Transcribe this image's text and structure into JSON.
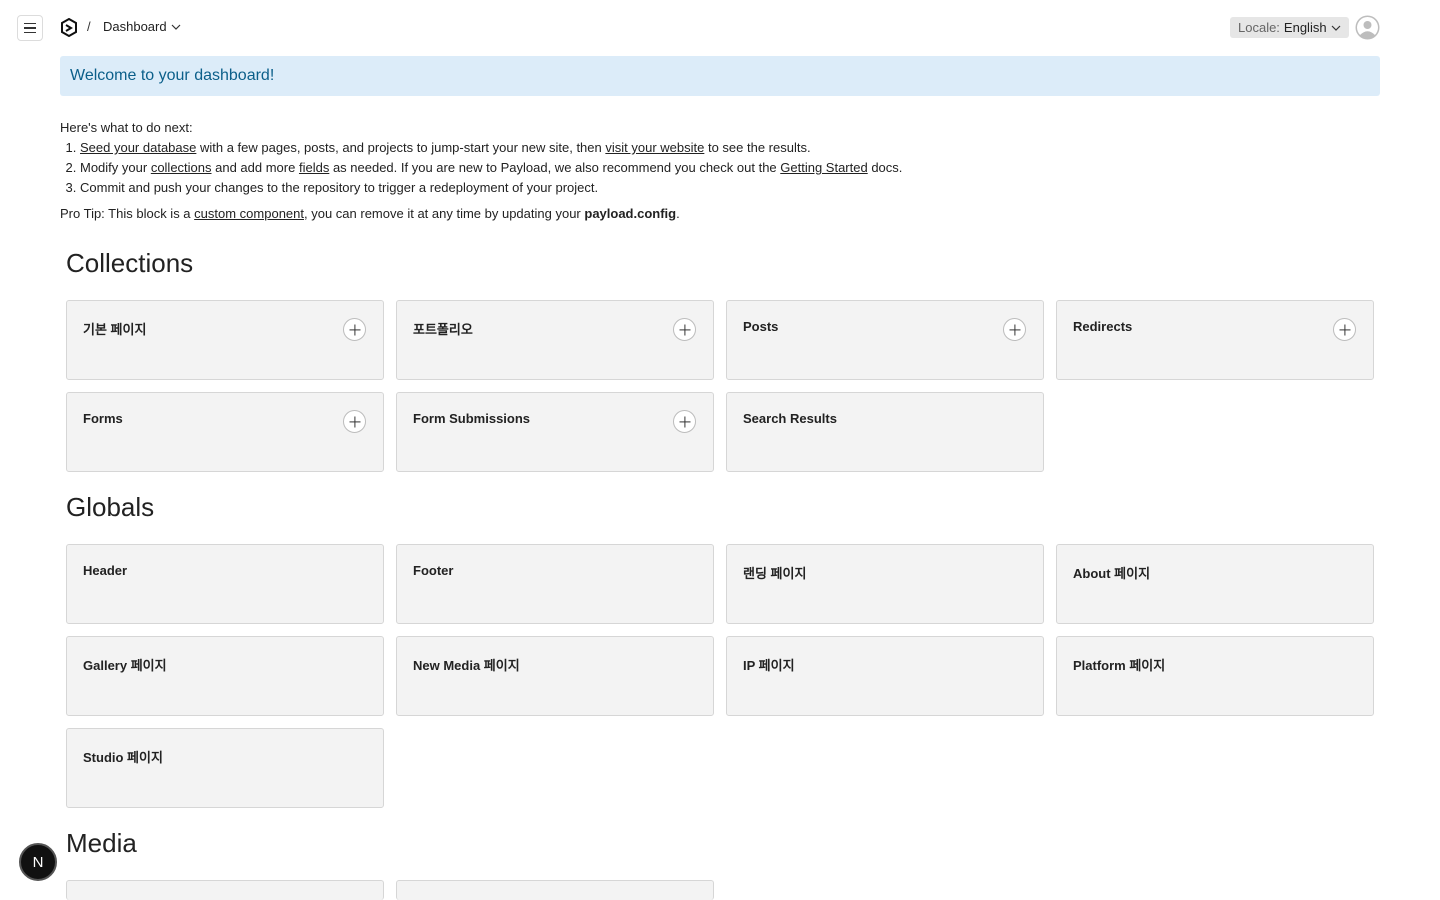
{
  "header": {
    "breadcrumb_separator": "/",
    "breadcrumb_current": "Dashboard",
    "locale_label": "Locale:",
    "locale_value": "English"
  },
  "banner": {
    "text": "Welcome to your dashboard!"
  },
  "intro": {
    "heading": "Here's what to do next:",
    "step1": {
      "link1": "Seed your database",
      "text1": " with a few pages, posts, and projects to jump-start your new site, then ",
      "link2": "visit your website",
      "text2": " to see the results."
    },
    "step2": {
      "text1": "Modify your ",
      "link1": "collections",
      "text2": " and add more ",
      "link2": "fields",
      "text3": " as needed. If you are new to Payload, we also recommend you check out the ",
      "link3": "Getting Started",
      "text4": " docs."
    },
    "step3": {
      "text": "Commit and push your changes to the repository to trigger a redeployment of your project."
    },
    "tip": {
      "text1": "Pro Tip: This block is a ",
      "link": "custom component",
      "text2": ", you can remove it at any time by updating your ",
      "bold": "payload.config",
      "text3": "."
    }
  },
  "collections": {
    "title": "Collections",
    "items": [
      "기본 페이지",
      "포트폴리오",
      "Posts",
      "Redirects",
      "Forms",
      "Form Submissions",
      "Search Results"
    ]
  },
  "globals": {
    "title": "Globals",
    "items": [
      "Header",
      "Footer",
      "랜딩 페이지",
      "About 페이지",
      "Gallery 페이지",
      "New Media 페이지",
      "IP 페이지",
      "Platform 페이지",
      "Studio 페이지"
    ]
  },
  "media": {
    "title": "Media"
  },
  "dev_badge": {
    "letter": "N"
  },
  "colors": {
    "banner_bg": "#dcecf9",
    "banner_text": "#0b5f8a",
    "card_bg": "#f3f3f3"
  },
  "icons": [
    "hamburger-icon",
    "payload-logo-icon",
    "chevron-down-icon",
    "user-avatar-icon",
    "plus-icon"
  ]
}
